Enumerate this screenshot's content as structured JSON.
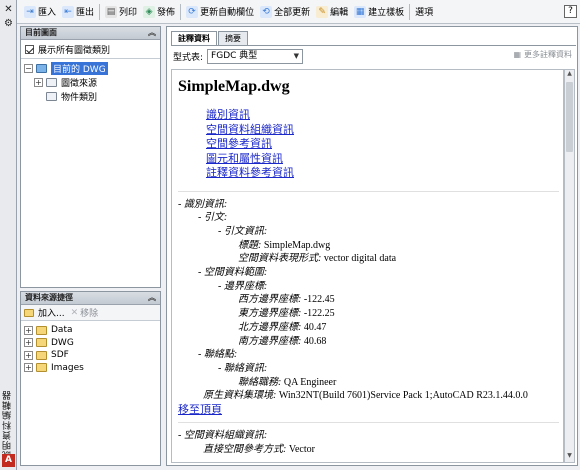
{
  "side_strip": {
    "close": "✕",
    "settings": "⚙",
    "title": "說明資料編輯器",
    "logo": "A"
  },
  "toolbar": {
    "items": [
      {
        "label": "匯入",
        "icon": "import-icon",
        "color": "#3a7bd5"
      },
      {
        "label": "匯出",
        "icon": "export-icon",
        "color": "#3a7bd5"
      },
      {
        "label": "列印",
        "icon": "print-icon",
        "color": "#555555"
      },
      {
        "label": "發佈",
        "icon": "publish-icon",
        "color": "#2e8b57"
      },
      {
        "label": "更新自動欄位",
        "icon": "update-fields-icon",
        "color": "#3a7bd5"
      },
      {
        "label": "全部更新",
        "icon": "update-all-icon",
        "color": "#3a7bd5"
      },
      {
        "label": "編輯",
        "icon": "edit-icon",
        "color": "#c48a1a"
      },
      {
        "label": "建立樣板",
        "icon": "template-icon",
        "color": "#3a7bd5"
      },
      {
        "label": "選項",
        "icon": "",
        "color": ""
      }
    ],
    "help": "?"
  },
  "current_map": {
    "header": "目前圖面",
    "show_all_label": "展示所有圖徵類別",
    "tree": [
      {
        "label": "目前的 DWG",
        "level": 0,
        "selected": true
      },
      {
        "label": "圖徵來源",
        "level": 1
      },
      {
        "label": "物件類別",
        "level": 1
      }
    ]
  },
  "data_sources": {
    "header": "資料來源捷徑",
    "add_label": "加入...",
    "remove_label": "移除",
    "items": [
      "Data",
      "DWG",
      "SDF",
      "Images"
    ]
  },
  "tabs": [
    "註釋資料",
    "摘要"
  ],
  "format": {
    "label": "型式表:",
    "value": "FGDC 典型",
    "more_label": "更多註釋資料"
  },
  "doc": {
    "title": "SimpleMap.dwg",
    "toc": [
      "識別資訊",
      "空間資料組織資訊",
      "空間參考資訊",
      "圖元和屬性資訊",
      "註釋資料參考資訊"
    ],
    "lines": [
      {
        "indent": 0,
        "label": "- 識別資訊:",
        "value": ""
      },
      {
        "indent": 1,
        "label": "- 引文:",
        "value": ""
      },
      {
        "indent": 2,
        "label": "- 引文資訊:",
        "value": ""
      },
      {
        "indent": 3,
        "label": "標題:",
        "value": "SimpleMap.dwg"
      },
      {
        "indent": 3,
        "label": "空間資料表現形式:",
        "value": "vector digital data"
      },
      {
        "indent": 1,
        "label": "- 空間資料範圍:",
        "value": ""
      },
      {
        "indent": 2,
        "label": "- 邊界座標:",
        "value": ""
      },
      {
        "indent": 3,
        "label": "西方邊界座標:",
        "value": "-122.45"
      },
      {
        "indent": 3,
        "label": "東方邊界座標:",
        "value": "-122.25"
      },
      {
        "indent": 3,
        "label": "北方邊界座標:",
        "value": "40.47"
      },
      {
        "indent": 3,
        "label": "南方邊界座標:",
        "value": "40.68"
      },
      {
        "indent": 1,
        "label": "- 聯絡點:",
        "value": ""
      },
      {
        "indent": 2,
        "label": "- 聯絡資訊:",
        "value": ""
      },
      {
        "indent": 3,
        "label": "聯絡職務:",
        "value": "QA Engineer"
      },
      {
        "indent": 1.25,
        "label": "原生資料集環境:",
        "value": "Win32NT(Build 7601)Service Pack 1;AutoCAD R23.1.44.0.0"
      }
    ],
    "back_to_top": "移至頂頁",
    "lines2": [
      {
        "indent": 0,
        "label": "- 空間資料組織資訊:",
        "value": ""
      },
      {
        "indent": 1.25,
        "label": "直接空間參考方式:",
        "value": "Vector"
      }
    ]
  }
}
